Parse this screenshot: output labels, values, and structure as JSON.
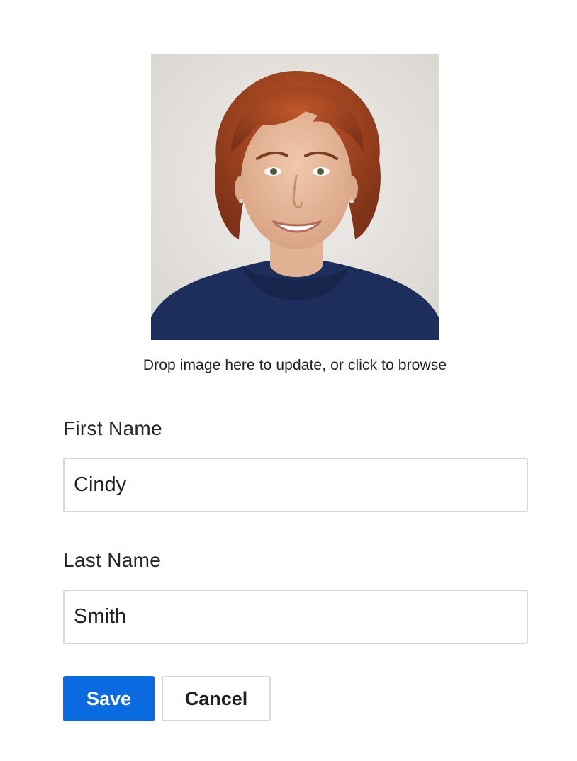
{
  "avatar": {
    "description_icon": "profile-photo",
    "drop_hint": "Drop image here to update, or click to browse"
  },
  "form": {
    "first_name": {
      "label": "First Name",
      "value": "Cindy"
    },
    "last_name": {
      "label": "Last Name",
      "value": "Smith"
    }
  },
  "actions": {
    "save_label": "Save",
    "cancel_label": "Cancel"
  },
  "colors": {
    "primary": "#0a6be0",
    "input_border": "#d6d6d6",
    "text": "#1f1f1f"
  }
}
